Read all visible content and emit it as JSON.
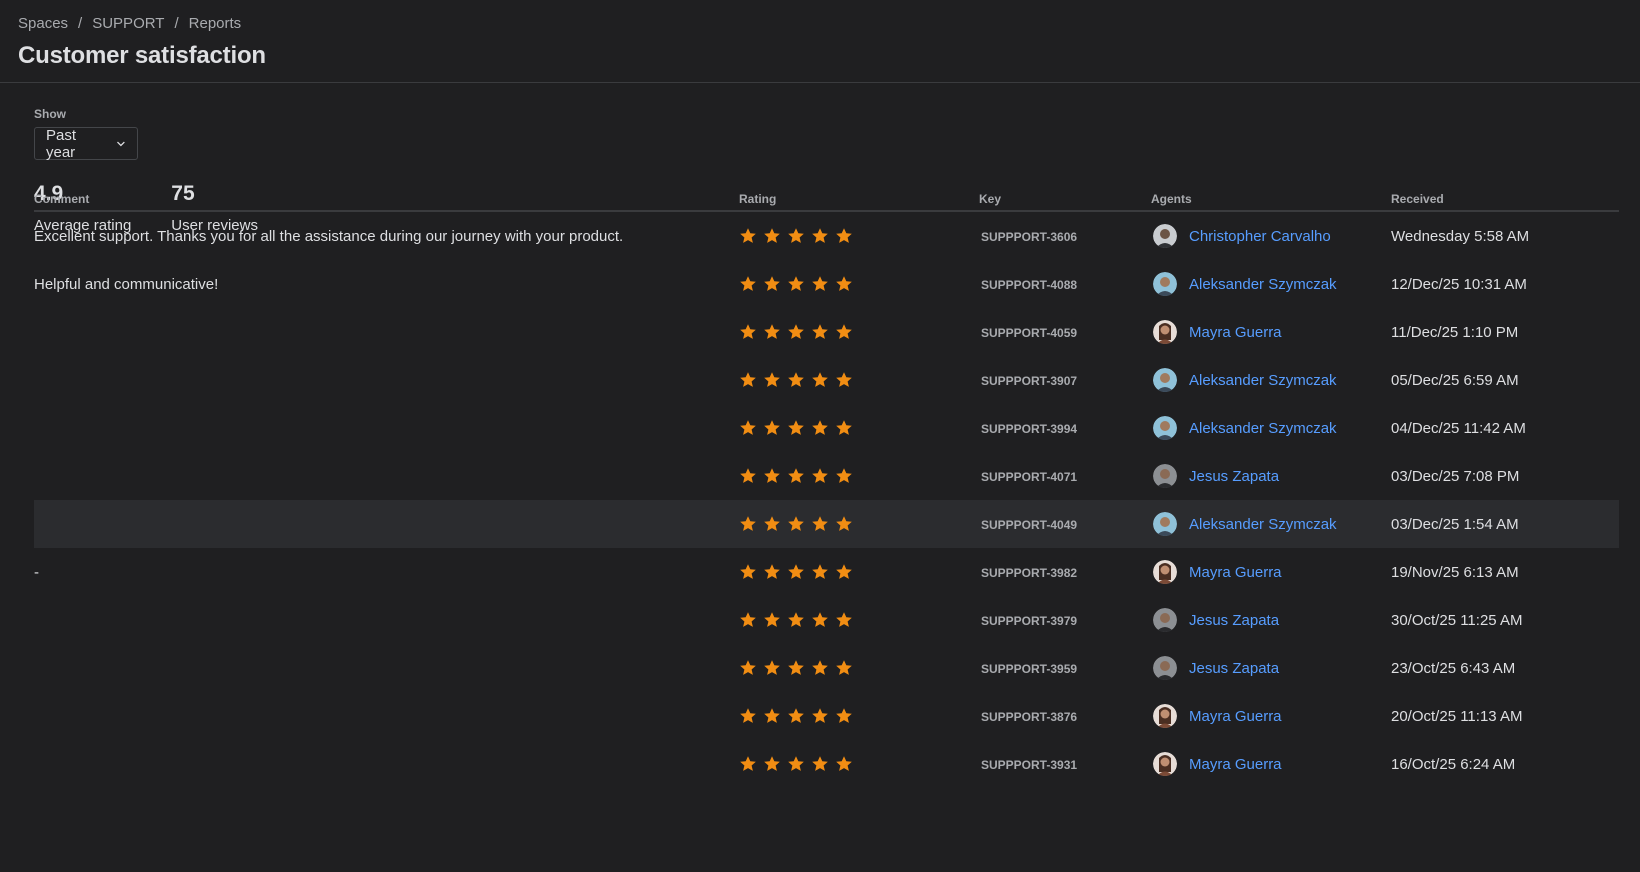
{
  "breadcrumb": [
    "Spaces",
    "SUPPORT",
    "Reports"
  ],
  "page_title": "Customer satisfaction",
  "filter": {
    "label": "Show",
    "value": "Past year"
  },
  "stats": [
    {
      "value": "4.9",
      "label": "Average rating"
    },
    {
      "value": "75",
      "label": "User reviews"
    }
  ],
  "table": {
    "headers": [
      "Comment",
      "Rating",
      "Key",
      "Agents",
      "Received"
    ],
    "star_color": "#f18d13",
    "link_color": "#579dff",
    "rows": [
      {
        "comment": "Excellent support. Thanks you for all the assistance during our journey with your product.",
        "rating": 5,
        "key": "SUPPPORT-3606",
        "agent": "Christopher Carvalho",
        "avatar": "a1",
        "received": "Wednesday 5:58 AM"
      },
      {
        "comment": "Helpful and communicative!",
        "rating": 5,
        "key": "SUPPPORT-4088",
        "agent": "Aleksander Szymczak",
        "avatar": "a2",
        "received": "12/Dec/25 10:31 AM"
      },
      {
        "comment": "",
        "rating": 5,
        "key": "SUPPPORT-4059",
        "agent": "Mayra Guerra",
        "avatar": "a3",
        "received": "11/Dec/25 1:10 PM"
      },
      {
        "comment": "",
        "rating": 5,
        "key": "SUPPPORT-3907",
        "agent": "Aleksander Szymczak",
        "avatar": "a2",
        "received": "05/Dec/25 6:59 AM"
      },
      {
        "comment": "",
        "rating": 5,
        "key": "SUPPPORT-3994",
        "agent": "Aleksander Szymczak",
        "avatar": "a2",
        "received": "04/Dec/25 11:42 AM"
      },
      {
        "comment": "",
        "rating": 5,
        "key": "SUPPPORT-4071",
        "agent": "Jesus Zapata",
        "avatar": "a4",
        "received": "03/Dec/25 7:08 PM"
      },
      {
        "comment": "",
        "rating": 5,
        "key": "SUPPPORT-4049",
        "agent": "Aleksander Szymczak",
        "avatar": "a2",
        "received": "03/Dec/25 1:54 AM",
        "hover": true
      },
      {
        "comment": "-",
        "rating": 5,
        "key": "SUPPPORT-3982",
        "agent": "Mayra Guerra",
        "avatar": "a3",
        "received": "19/Nov/25 6:13 AM"
      },
      {
        "comment": "",
        "rating": 5,
        "key": "SUPPPORT-3979",
        "agent": "Jesus Zapata",
        "avatar": "a4",
        "received": "30/Oct/25 11:25 AM"
      },
      {
        "comment": "",
        "rating": 5,
        "key": "SUPPPORT-3959",
        "agent": "Jesus Zapata",
        "avatar": "a4",
        "received": "23/Oct/25 6:43 AM"
      },
      {
        "comment": "",
        "rating": 5,
        "key": "SUPPPORT-3876",
        "agent": "Mayra Guerra",
        "avatar": "a3",
        "received": "20/Oct/25 11:13 AM"
      },
      {
        "comment": "",
        "rating": 5,
        "key": "SUPPPORT-3931",
        "agent": "Mayra Guerra",
        "avatar": "a3",
        "received": "16/Oct/25 6:24 AM"
      }
    ]
  }
}
